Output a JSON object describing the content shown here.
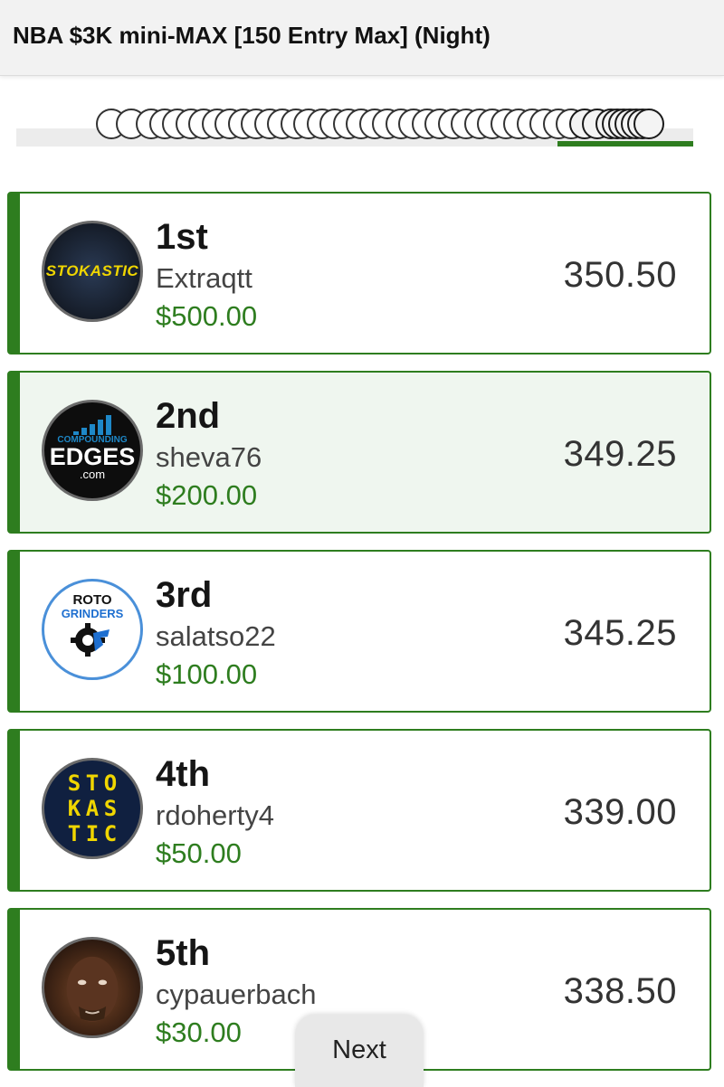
{
  "header": {
    "title": "NBA $3K mini-MAX [150 Entry Max] (Night)"
  },
  "payout_progress": {
    "filled_fraction": 0.2
  },
  "entries": [
    {
      "rank": "1st",
      "username": "Extraqtt",
      "prize": "$500.00",
      "score": "350.50",
      "avatar": "stokastic-logo",
      "avatar_text": "STOKASTIC",
      "highlighted": false
    },
    {
      "rank": "2nd",
      "username": "sheva76",
      "prize": "$200.00",
      "score": "349.25",
      "avatar": "compounding-edges-logo",
      "avatar_text": [
        "COMPOUNDING",
        "EDGES",
        ".com"
      ],
      "highlighted": true
    },
    {
      "rank": "3rd",
      "username": "salatso22",
      "prize": "$100.00",
      "score": "345.25",
      "avatar": "rotogrinders-logo",
      "avatar_text": [
        "ROTO",
        "GRINDERS"
      ],
      "highlighted": false
    },
    {
      "rank": "4th",
      "username": "rdoherty4",
      "prize": "$50.00",
      "score": "339.00",
      "avatar": "stokastic-block-logo",
      "avatar_text": [
        "S",
        "T",
        "O",
        "K",
        "A",
        "S",
        "T",
        "I",
        "C"
      ],
      "highlighted": false
    },
    {
      "rank": "5th",
      "username": "cypauerbach",
      "prize": "$30.00",
      "score": "338.50",
      "avatar": "user-photo",
      "highlighted": false
    }
  ],
  "pagination": {
    "next_label": "Next"
  },
  "colors": {
    "accent": "#2e7d1f",
    "highlight_bg": "#eff6ef",
    "text": "#151515"
  }
}
